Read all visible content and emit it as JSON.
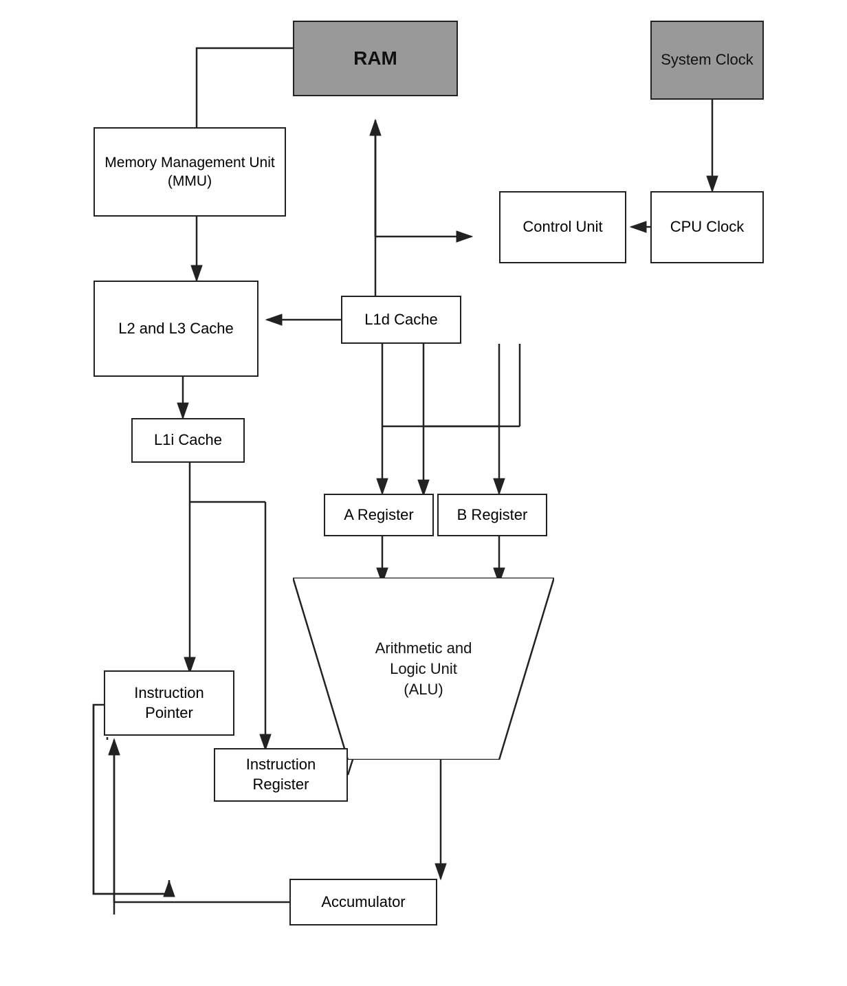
{
  "boxes": {
    "ram": {
      "label": "RAM"
    },
    "system_clock": {
      "label": "System Clock"
    },
    "mmu": {
      "label": "Memory Management Unit (MMU)"
    },
    "control_unit": {
      "label": "Control Unit"
    },
    "cpu_clock": {
      "label": "CPU Clock"
    },
    "l2l3_cache": {
      "label": "L2 and L3 Cache"
    },
    "l1d_cache": {
      "label": "L1d Cache"
    },
    "l1i_cache": {
      "label": "L1i Cache"
    },
    "a_register": {
      "label": "A Register"
    },
    "b_register": {
      "label": "B Register"
    },
    "alu": {
      "label": "Arithmetic and Logic Unit (ALU)"
    },
    "instruction_pointer": {
      "label": "Instruction Pointer"
    },
    "instruction_register": {
      "label": "Instruction Register"
    },
    "accumulator": {
      "label": "Accumulator"
    }
  }
}
